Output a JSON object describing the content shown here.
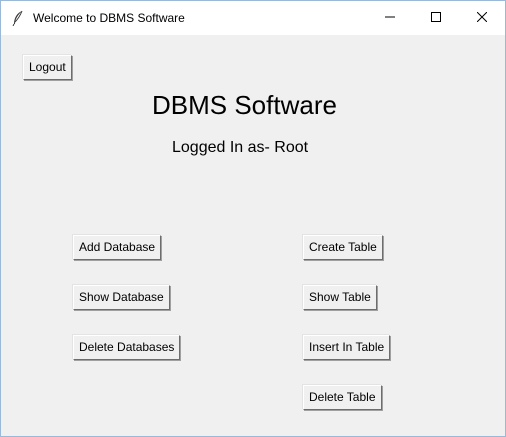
{
  "window": {
    "title": "Welcome to DBMS Software"
  },
  "toolbar": {
    "logout_label": "Logout"
  },
  "main": {
    "title": "DBMS Software",
    "logged_in_text": "Logged In as- Root"
  },
  "database_buttons": {
    "add": "Add Database",
    "show": "Show Database",
    "delete": "Delete Databases"
  },
  "table_buttons": {
    "create": "Create Table",
    "show": "Show Table",
    "insert": "Insert In Table",
    "delete": "Delete Table"
  },
  "icons": {
    "app": "feather-icon",
    "minimize": "minimize-icon",
    "maximize": "maximize-icon",
    "close": "close-icon"
  }
}
